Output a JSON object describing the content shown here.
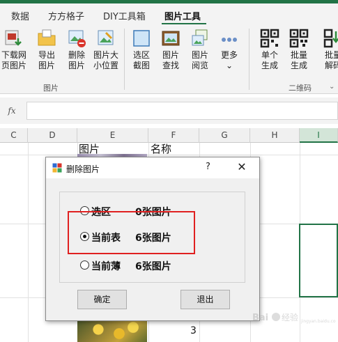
{
  "ribbon": {
    "tabs": [
      "数据",
      "方方格子",
      "DIY工具箱",
      "图片工具"
    ],
    "active_tab": "图片工具",
    "buttons": [
      {
        "line1": "下载网",
        "line2": "页图片"
      },
      {
        "line1": "导出",
        "line2": "图片"
      },
      {
        "line1": "删除",
        "line2": "图片"
      },
      {
        "line1": "图片大",
        "line2": "小位置"
      },
      {
        "line1": "选区",
        "line2": "截图"
      },
      {
        "line1": "图片",
        "line2": "查找"
      },
      {
        "line1": "图片",
        "line2": "阅览"
      },
      {
        "line1": "更多",
        "line2": "⌄"
      },
      {
        "line1": "单个",
        "line2": "生成"
      },
      {
        "line1": "批量",
        "line2": "生成"
      },
      {
        "line1": "批量",
        "line2": "解码"
      }
    ],
    "groups": [
      "图片",
      "二维码"
    ],
    "collapse_glyph": "⌄"
  },
  "formula_bar": {
    "fx_label": "fx",
    "value": ""
  },
  "grid": {
    "columns": [
      "C",
      "D",
      "E",
      "F",
      "G",
      "H",
      "I"
    ],
    "selected_column": "I",
    "cells": {
      "e_header": "图片",
      "f_header": "名称",
      "f_row_value": "3"
    }
  },
  "dialog": {
    "title": "删除图片",
    "help": "?",
    "close": "✕",
    "options": [
      {
        "label": "选区",
        "count": "0张图片",
        "checked": false
      },
      {
        "label": "当前表",
        "count": "6张图片",
        "checked": true
      },
      {
        "label": "当前薄",
        "count": "6张图片",
        "checked": false
      }
    ],
    "ok_label": "确定",
    "exit_label": "退出"
  },
  "watermark": {
    "text": "Bai 经验",
    "url": "jingyan.baidu.com"
  },
  "colors": {
    "excel_green": "#217346",
    "highlight_red": "#e02020"
  }
}
